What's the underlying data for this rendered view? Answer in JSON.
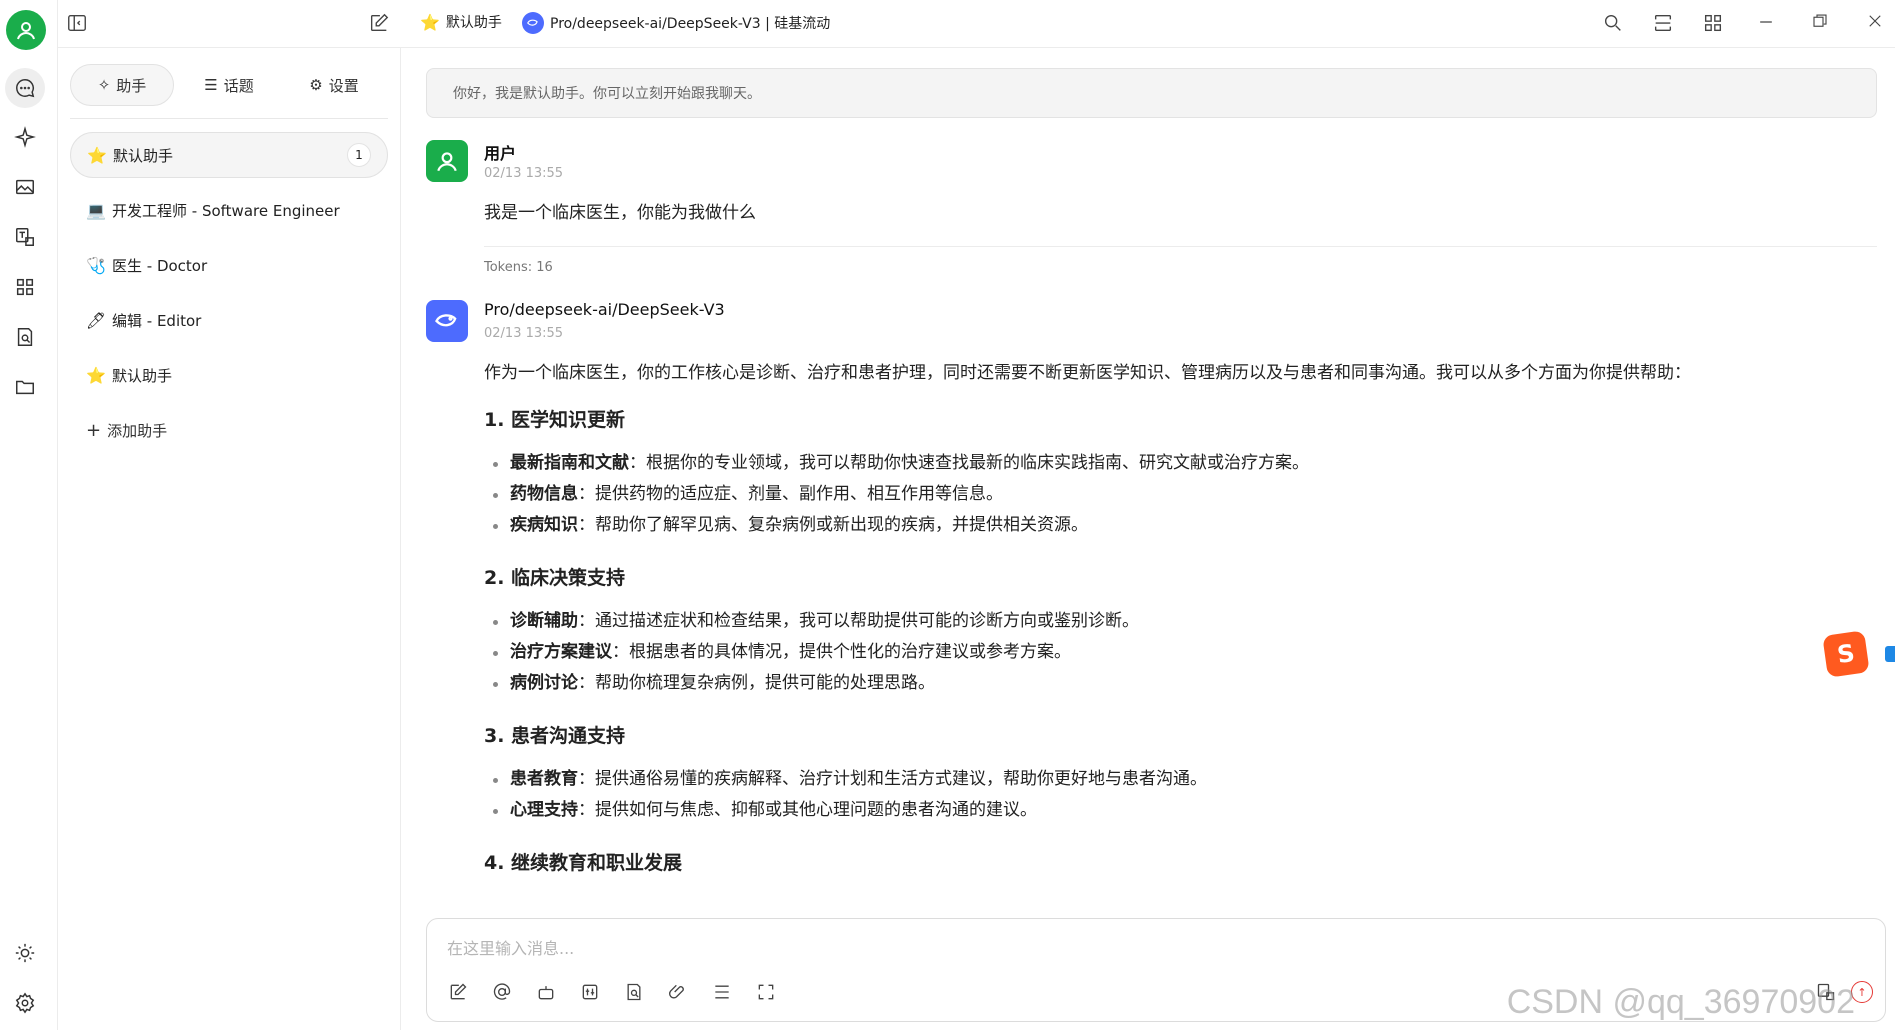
{
  "titlebar": {
    "assistant_name": "默认助手",
    "model_name": "Pro/deepseek-ai/DeepSeek-V3 | 硅基流动"
  },
  "panel": {
    "tabs": [
      {
        "label": "助手",
        "icon": "sparkle-icon"
      },
      {
        "label": "话题",
        "icon": "list-icon"
      },
      {
        "label": "设置",
        "icon": "gear-icon"
      }
    ],
    "assistants": [
      {
        "emoji": "⭐",
        "label": "默认助手",
        "count": "1"
      },
      {
        "emoji": "💻",
        "label": "开发工程师 - Software Engineer"
      },
      {
        "emoji": "🩺",
        "label": "医生 - Doctor"
      },
      {
        "emoji": "🖊",
        "label": "编辑 - Editor"
      },
      {
        "emoji": "⭐",
        "label": "默认助手"
      }
    ],
    "add_label": "添加助手"
  },
  "chat": {
    "greeting": "你好，我是默认助手。你可以立刻开始跟我聊天。",
    "user_message": {
      "name": "用户",
      "time": "02/13 13:55",
      "text": "我是一个临床医生，你能为我做什么",
      "tokens": "Tokens: 16"
    },
    "ai_message": {
      "name": "Pro/deepseek-ai/DeepSeek-V3",
      "time": "02/13 13:55",
      "intro": "作为一个临床医生，你的工作核心是诊断、治疗和患者护理，同时还需要不断更新医学知识、管理病历以及与患者和同事沟通。我可以从多个方面为你提供帮助：",
      "sections": [
        {
          "title": "1. 医学知识更新",
          "items": [
            {
              "bold": "最新指南和文献",
              "text": "：根据你的专业领域，我可以帮助你快速查找最新的临床实践指南、研究文献或治疗方案。"
            },
            {
              "bold": "药物信息",
              "text": "：提供药物的适应症、剂量、副作用、相互作用等信息。"
            },
            {
              "bold": "疾病知识",
              "text": "：帮助你了解罕见病、复杂病例或新出现的疾病，并提供相关资源。"
            }
          ]
        },
        {
          "title": "2. 临床决策支持",
          "items": [
            {
              "bold": "诊断辅助",
              "text": "：通过描述症状和检查结果，我可以帮助提供可能的诊断方向或鉴别诊断。"
            },
            {
              "bold": "治疗方案建议",
              "text": "：根据患者的具体情况，提供个性化的治疗建议或参考方案。"
            },
            {
              "bold": "病例讨论",
              "text": "：帮助你梳理复杂病例，提供可能的处理思路。"
            }
          ]
        },
        {
          "title": "3. 患者沟通支持",
          "items": [
            {
              "bold": "患者教育",
              "text": "：提供通俗易懂的疾病解释、治疗计划和生活方式建议，帮助你更好地与患者沟通。"
            },
            {
              "bold": "心理支持",
              "text": "：提供如何与焦虑、抑郁或其他心理问题的患者沟通的建议。"
            }
          ]
        },
        {
          "title": "4. 继续教育和职业发展",
          "items": []
        }
      ]
    }
  },
  "input": {
    "placeholder": "在这里输入消息..."
  },
  "watermark": "CSDN @qq_36970902",
  "colors": {
    "user_avatar": "#1aad4b",
    "model_badge": "#4d6bfe",
    "ime": "#ff5a1f"
  }
}
